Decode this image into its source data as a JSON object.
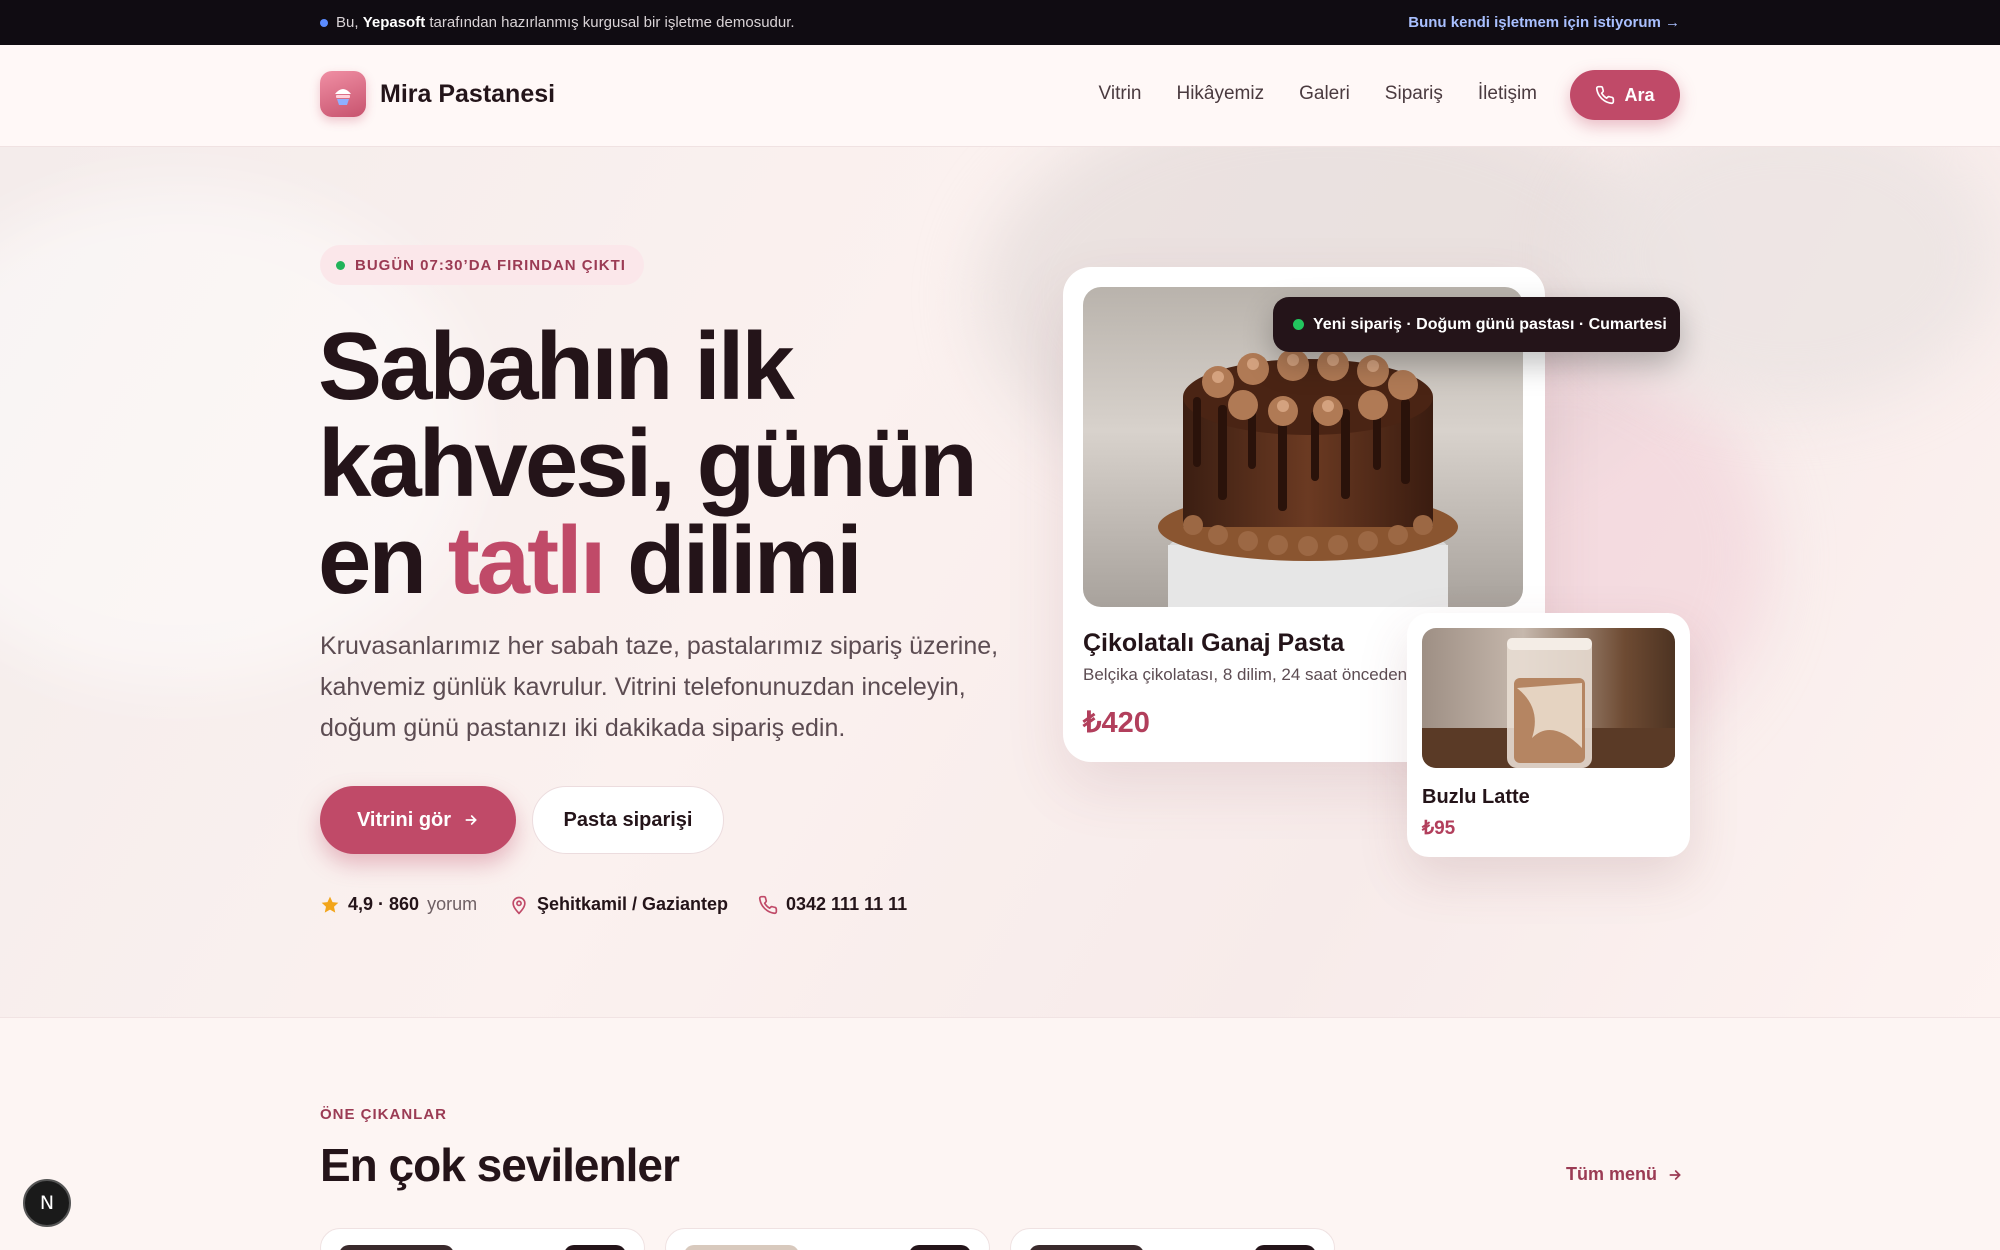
{
  "topbar": {
    "notice_prefix": "Bu,",
    "notice_brand": "Yepasoft",
    "notice_suffix": "tarafından hazırlanmış kurgusal bir işletme demosudur.",
    "cta": "Bunu kendi işletmem için istiyorum →"
  },
  "nav": {
    "brand": "Mira Pastanesi",
    "items": [
      "Vitrin",
      "Hikâyemiz",
      "Galeri",
      "Sipariş",
      "İletişim"
    ],
    "call_label": "Ara"
  },
  "hero": {
    "badge": "BUGÜN 07:30’DA FIRINDAN ÇIKTI",
    "headline_line1": "Sabahın ilk",
    "headline_line2": "kahvesi, günün",
    "headline_line3_pre": "en",
    "headline_accent": "tatlı",
    "headline_line3_post": "dilimi",
    "lead": "Kruvasanlarımız her sabah taze, pastalarımız sipariş üzerine, kahvemiz günlük kavrulur. Vitrini telefonunuzdan inceleyin, doğum günü pastanızı iki dakikada sipariş edin.",
    "primary_button": "Vitrini gör",
    "secondary_button": "Pasta siparişi",
    "rating": "4,9 · 860",
    "rating_suffix": "yorum",
    "location": "Şehitkamil / Gaziantep",
    "phone": "0342 111 11 11"
  },
  "feature_card": {
    "title": "Çikolatalı Ganaj Pasta",
    "subtitle": "Belçika çikolatası, 8 dilim, 24 saat önceden",
    "price": "₺420"
  },
  "toast": {
    "text": "Yeni sipariş · Doğum günü pastası · Cumartesi"
  },
  "mini_card": {
    "title": "Buzlu Latte",
    "price": "₺95"
  },
  "featured": {
    "eyebrow": "ÖNE ÇIKANLAR",
    "title": "En çok sevilenler",
    "all_link": "Tüm menü"
  },
  "fab": {
    "label": "N"
  },
  "colors": {
    "accent": "#c04a68",
    "dark": "#241419",
    "status_green": "#22b35a"
  }
}
